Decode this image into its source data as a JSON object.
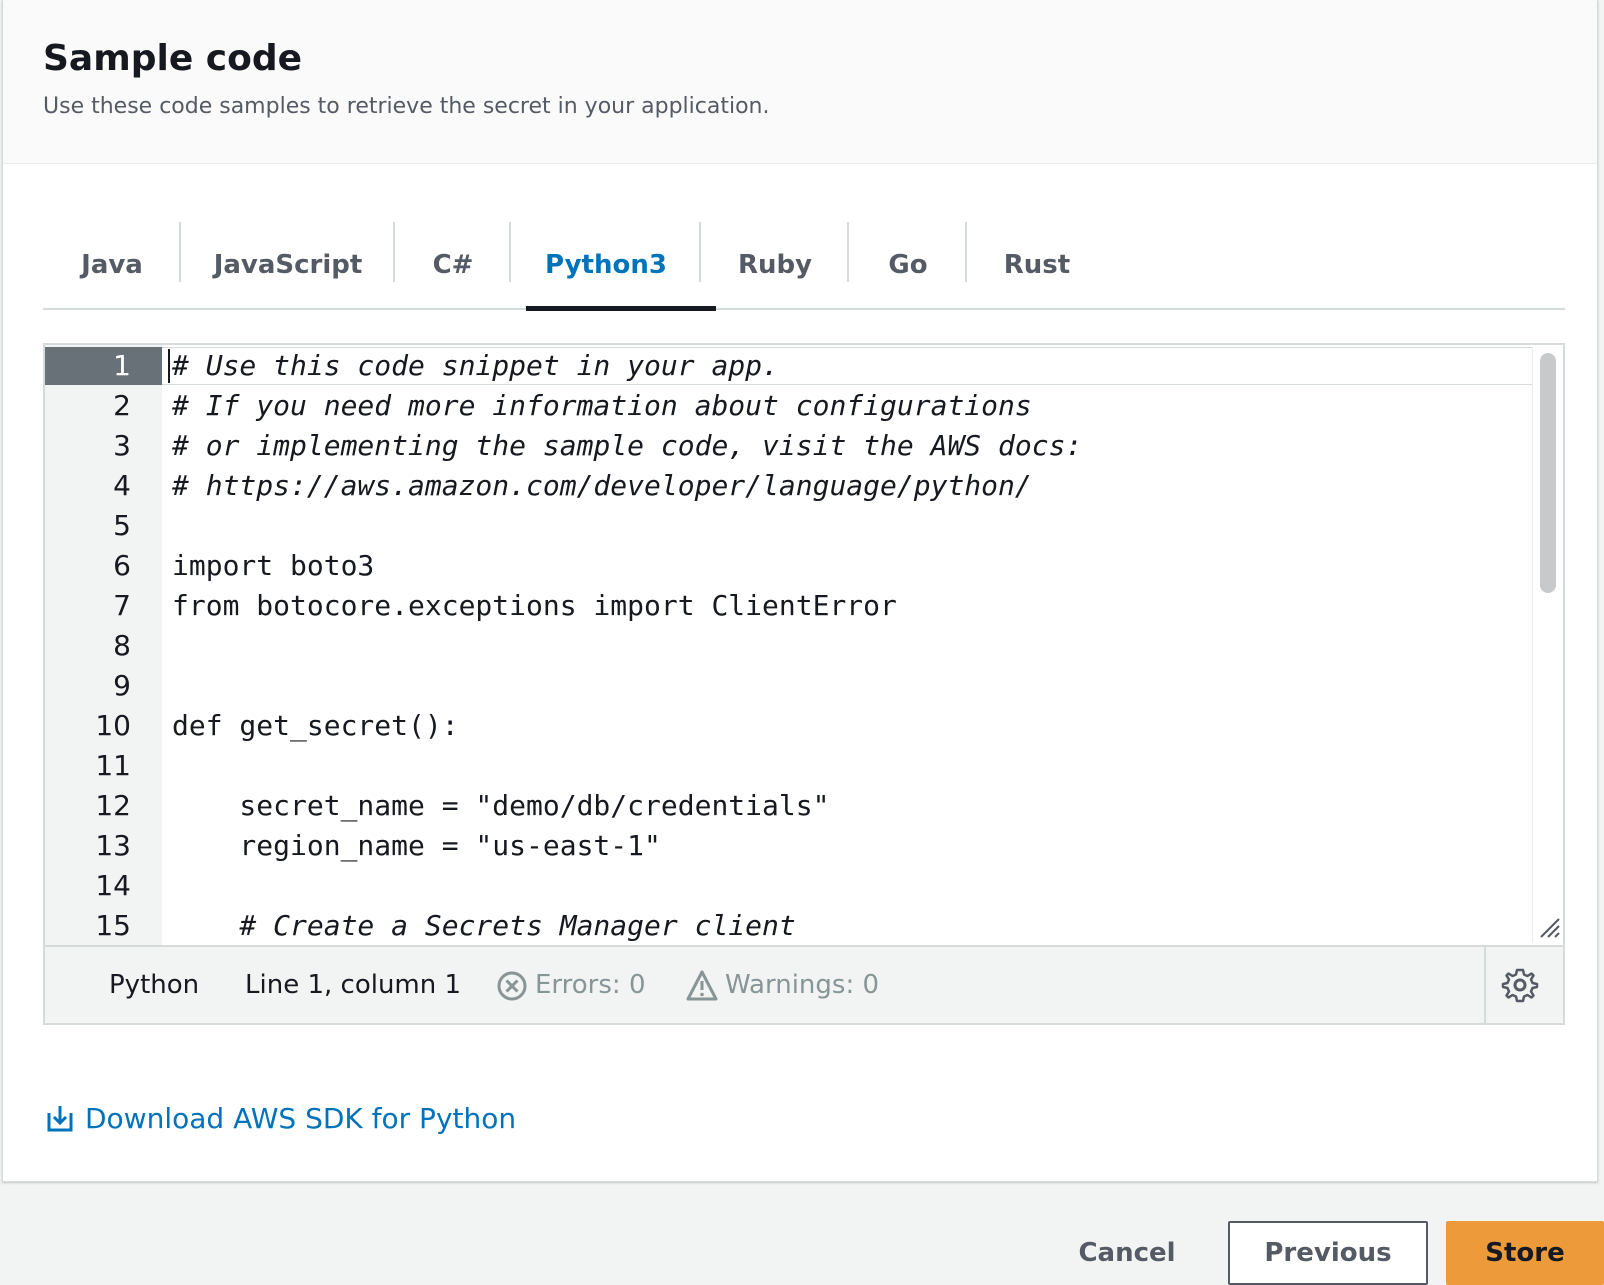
{
  "header": {
    "title": "Sample code",
    "subtitle": "Use these code samples to retrieve the secret in your application."
  },
  "tabs": [
    {
      "label": "Java",
      "active": false
    },
    {
      "label": "JavaScript",
      "active": false
    },
    {
      "label": "C#",
      "active": false
    },
    {
      "label": "Python3",
      "active": true
    },
    {
      "label": "Ruby",
      "active": false
    },
    {
      "label": "Go",
      "active": false
    },
    {
      "label": "Rust",
      "active": false
    }
  ],
  "editor": {
    "active_line": 1,
    "line_numbers": [
      "1",
      "2",
      "3",
      "4",
      "5",
      "6",
      "7",
      "8",
      "9",
      "10",
      "11",
      "12",
      "13",
      "14",
      "15"
    ],
    "lines": [
      "# Use this code snippet in your app.",
      "# If you need more information about configurations",
      "# or implementing the sample code, visit the AWS docs:",
      "# https://aws.amazon.com/developer/language/python/",
      "",
      "import boto3",
      "from botocore.exceptions import ClientError",
      "",
      "",
      "def get_secret():",
      "",
      "    secret_name = \"demo/db/credentials\"",
      "    region_name = \"us-east-1\"",
      "",
      "    # Create a Secrets Manager client"
    ],
    "status": {
      "language": "Python",
      "position": "Line 1, column 1",
      "errors": "Errors: 0",
      "warnings": "Warnings: 0"
    }
  },
  "download_link": "Download AWS SDK for Python",
  "footer": {
    "cancel": "Cancel",
    "previous": "Previous",
    "store": "Store"
  },
  "colors": {
    "link": "#0073bb",
    "primary_button": "#ec9a3a",
    "active_gutter": "#687078"
  },
  "icons": {
    "errors": "x-circle-icon",
    "warnings": "warning-triangle-icon",
    "settings": "gear-icon",
    "download": "download-icon",
    "resize": "resize-handle-icon"
  }
}
